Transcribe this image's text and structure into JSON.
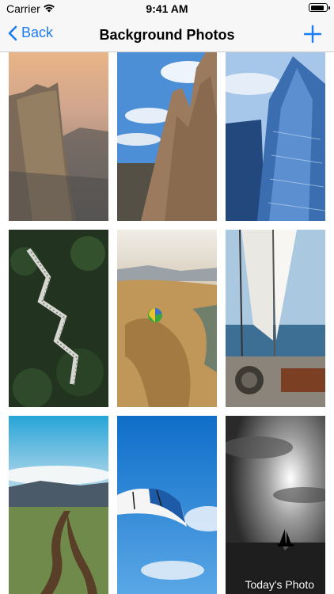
{
  "status_bar": {
    "carrier": "Carrier",
    "time": "9:41 AM",
    "battery_level": 0.9
  },
  "nav": {
    "back_label": "Back",
    "title": "Background Photos"
  },
  "icons": {
    "back": "chevron-left-icon",
    "add": "plus-icon",
    "wifi": "wifi-icon",
    "battery": "battery-icon"
  },
  "colors": {
    "accent": "#1a7cf5",
    "bar": "#f7f7f7"
  },
  "photos": [
    {
      "subject": "mountain-cliff"
    },
    {
      "subject": "rock-spire"
    },
    {
      "subject": "glass-skyscraper"
    },
    {
      "subject": "forest-stairway"
    },
    {
      "subject": "hot-air-balloon"
    },
    {
      "subject": "sailboat"
    },
    {
      "subject": "dirt-road"
    },
    {
      "subject": "paraglider"
    },
    {
      "subject": "black-white-sea",
      "caption": "Today's Photo"
    }
  ]
}
